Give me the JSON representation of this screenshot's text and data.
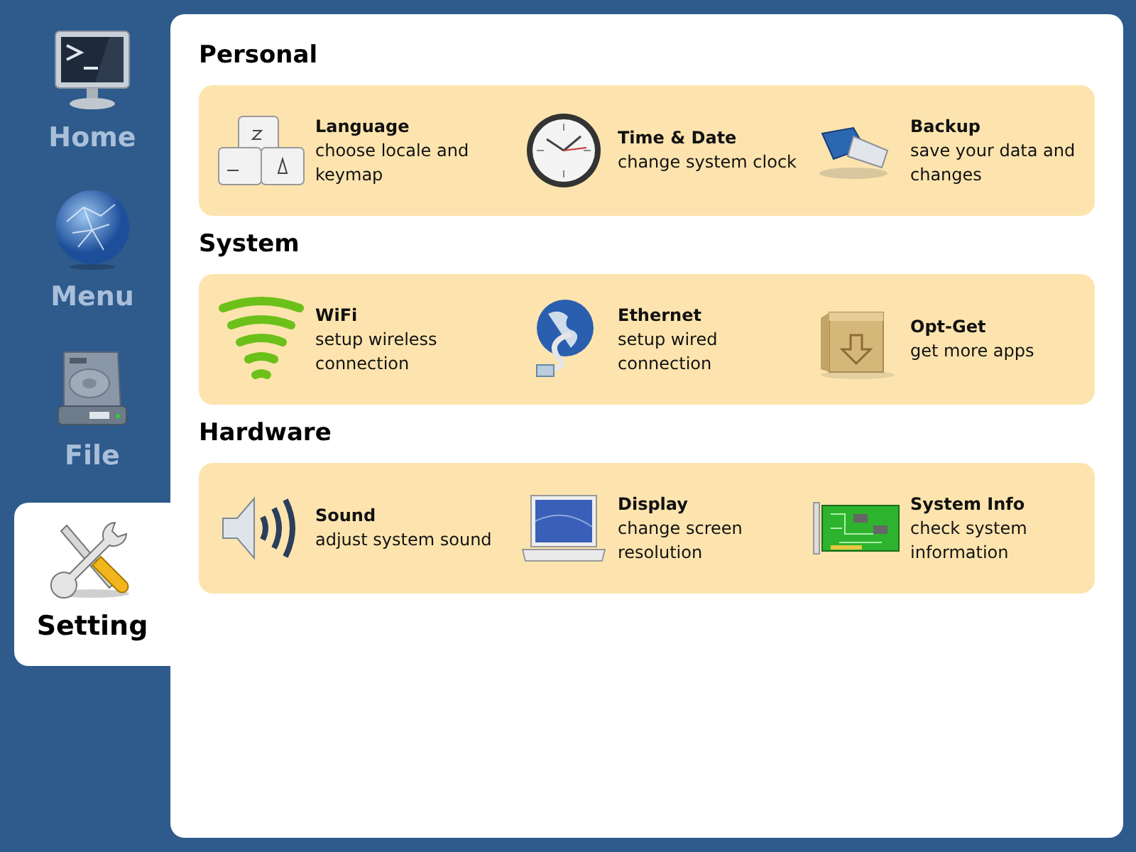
{
  "sidebar": {
    "items": [
      {
        "label": "Home",
        "selected": false
      },
      {
        "label": "Menu",
        "selected": false
      },
      {
        "label": "File",
        "selected": false
      },
      {
        "label": "Setting",
        "selected": true
      }
    ]
  },
  "sections": [
    {
      "title": "Personal",
      "items": [
        {
          "title": "Language",
          "description": "choose locale and keymap"
        },
        {
          "title": "Time & Date",
          "description": "change system clock"
        },
        {
          "title": "Backup",
          "description": "save your data and changes"
        }
      ]
    },
    {
      "title": "System",
      "items": [
        {
          "title": "WiFi",
          "description": "setup wireless connection"
        },
        {
          "title": "Ethernet",
          "description": "setup wired connection"
        },
        {
          "title": "Opt-Get",
          "description": "get more apps"
        }
      ]
    },
    {
      "title": "Hardware",
      "items": [
        {
          "title": "Sound",
          "description": "adjust system sound"
        },
        {
          "title": "Display",
          "description": "change screen resolution"
        },
        {
          "title": "System Info",
          "description": "check system information"
        }
      ]
    }
  ]
}
